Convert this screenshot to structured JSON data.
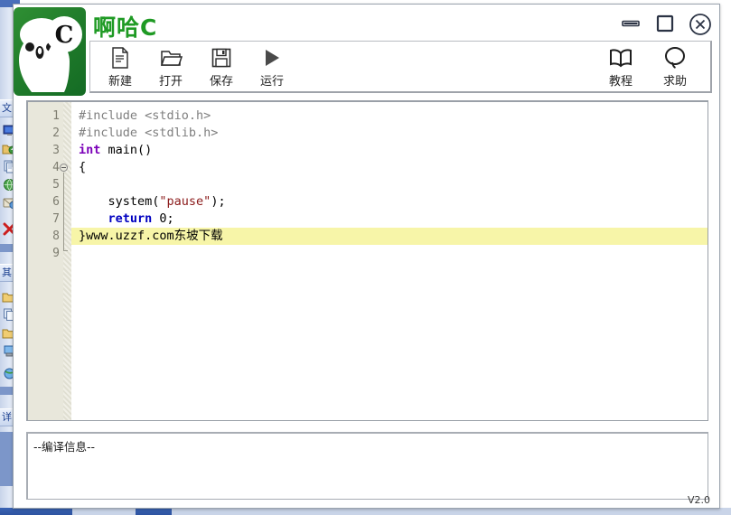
{
  "window": {
    "title": "啊哈C",
    "version_label": "V2.0",
    "controls": [
      {
        "name": "minimize",
        "label": "—"
      },
      {
        "name": "maximize",
        "label": "□"
      },
      {
        "name": "close",
        "label": "✕"
      }
    ]
  },
  "toolbar": {
    "left_buttons": [
      {
        "icon": "new-file-icon",
        "label": "新建"
      },
      {
        "icon": "open-folder-icon",
        "label": "打开"
      },
      {
        "icon": "save-floppy-icon",
        "label": "保存"
      },
      {
        "icon": "run-play-icon",
        "label": "运行"
      }
    ],
    "right_buttons": [
      {
        "icon": "book-icon",
        "label": "教程"
      },
      {
        "icon": "question-bubble-icon",
        "label": "求助"
      }
    ]
  },
  "editor": {
    "line_numbers": [
      "1",
      "2",
      "3",
      "4",
      "5",
      "6",
      "7",
      "8",
      "9"
    ],
    "fold_marker_line": 4,
    "highlighted_line": 8,
    "lines": [
      {
        "n": "1",
        "tokens": [
          {
            "t": "#include <stdio.h>",
            "c": "k-pre"
          }
        ]
      },
      {
        "n": "2",
        "tokens": [
          {
            "t": "#include <stdlib.h>",
            "c": "k-pre"
          }
        ]
      },
      {
        "n": "3",
        "tokens": [
          {
            "t": "int",
            "c": "k-kw2"
          },
          {
            "t": " main()",
            "c": "k-id"
          }
        ]
      },
      {
        "n": "4",
        "tokens": [
          {
            "t": "{",
            "c": "k-punct"
          }
        ]
      },
      {
        "n": "5",
        "tokens": [
          {
            "t": "",
            "c": "k-id"
          }
        ]
      },
      {
        "n": "6",
        "tokens": [
          {
            "t": "    system(",
            "c": "k-id"
          },
          {
            "t": "\"pause\"",
            "c": "k-str"
          },
          {
            "t": ");",
            "c": "k-punct"
          }
        ]
      },
      {
        "n": "7",
        "tokens": [
          {
            "t": "    ",
            "c": "k-id"
          },
          {
            "t": "return",
            "c": "k-kw"
          },
          {
            "t": " 0;",
            "c": "k-num"
          }
        ]
      },
      {
        "n": "8",
        "tokens": [
          {
            "t": "}",
            "c": "k-punct"
          },
          {
            "t": "www.uzzf.com东坡下载",
            "c": "k-wm"
          }
        ]
      },
      {
        "n": "9",
        "tokens": [
          {
            "t": "",
            "c": "k-id"
          }
        ]
      }
    ]
  },
  "output": {
    "text": "--编译信息--"
  },
  "background_app": {
    "strip_headers": [
      "文",
      "其",
      "详"
    ],
    "icons": [
      "monitor-icon",
      "folder-upload-icon",
      "documents-icon",
      "globe-green-icon",
      "mail-icon",
      "red-x-icon",
      "folder-yellow-icon",
      "copy-icon",
      "folder-yellow2-icon",
      "computer-blue-icon",
      "globe-small-icon"
    ]
  },
  "colors": {
    "brand_green": "#1f9a24",
    "logo_green": "#2f8f33",
    "highlight_yellow": "#f7f5a8",
    "gutter_bg": "#e8e7db",
    "keyword_blue": "#0000c0",
    "keyword_purple": "#7b00b8",
    "string_red": "#8b1a1a",
    "preproc_gray": "#7f7f7f",
    "taskbar_blue": "#3b64b4"
  }
}
